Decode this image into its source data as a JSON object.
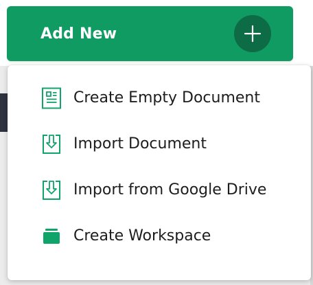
{
  "colors": {
    "brand_green": "#0f9b61",
    "plus_circle_bg": "#0d6b45",
    "icon_green": "#10a46a"
  },
  "header": {
    "add_new_label": "Add New",
    "plus_icon": "plus-icon"
  },
  "menu": {
    "items": [
      {
        "label": "Create Empty Document",
        "icon": "document-icon"
      },
      {
        "label": "Import Document",
        "icon": "import-icon"
      },
      {
        "label": "Import from Google Drive",
        "icon": "import-icon"
      },
      {
        "label": "Create Workspace",
        "icon": "workspace-icon"
      }
    ]
  }
}
